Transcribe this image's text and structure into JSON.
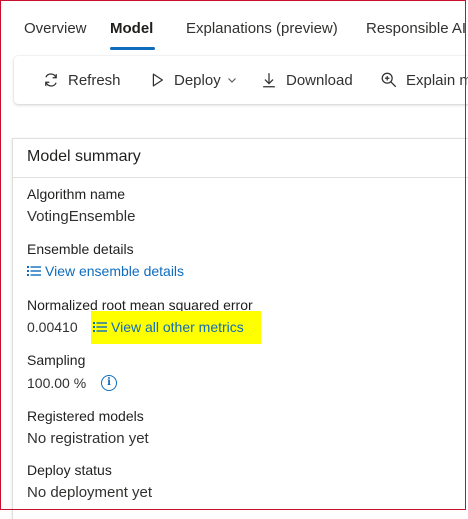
{
  "tabs": [
    {
      "label": "Overview"
    },
    {
      "label": "Model"
    },
    {
      "label": "Explanations (preview)"
    },
    {
      "label": "Responsible AI ("
    }
  ],
  "toolbar": {
    "refresh": "Refresh",
    "deploy": "Deploy",
    "download": "Download",
    "explain": "Explain m"
  },
  "summary": {
    "title": "Model summary",
    "algorithm_label": "Algorithm name",
    "algorithm_value": "VotingEnsemble",
    "ensemble_label": "Ensemble details",
    "ensemble_link": "View ensemble details",
    "nrmse_label": "Normalized root mean squared error",
    "nrmse_value": "0.00410",
    "metrics_link": "View all other metrics",
    "sampling_label": "Sampling",
    "sampling_value": "100.00 %",
    "registered_label": "Registered models",
    "registered_value": "No registration yet",
    "deploy_label": "Deploy status",
    "deploy_value": "No deployment yet"
  },
  "colors": {
    "accent": "#0f6cbd",
    "highlight": "#ffff00",
    "frame": "#c8102e"
  },
  "icons": [
    "refresh-icon",
    "deploy-icon",
    "chevron-down-icon",
    "download-icon",
    "explain-icon",
    "list-icon",
    "info-icon"
  ]
}
